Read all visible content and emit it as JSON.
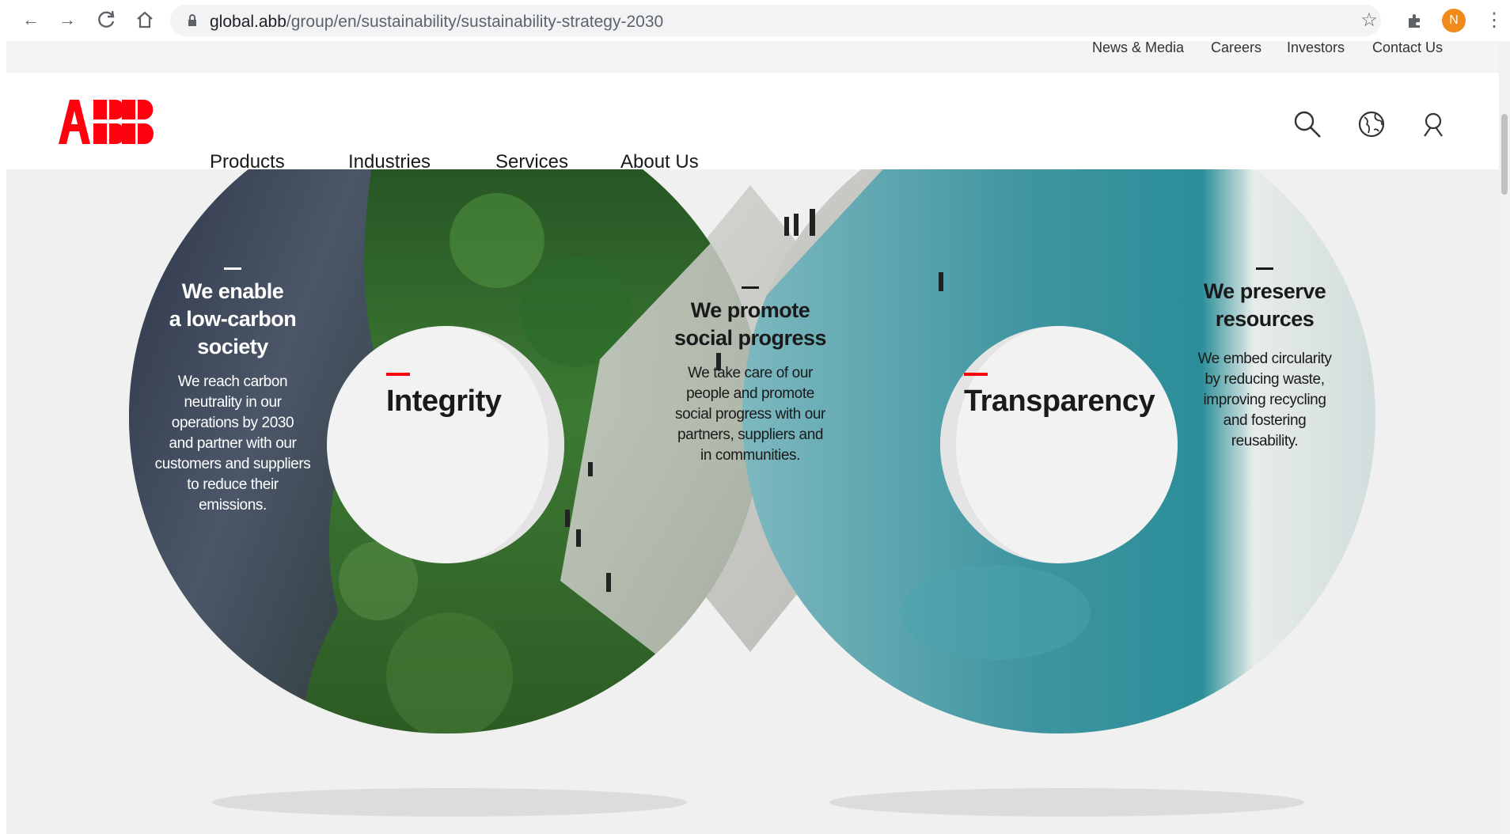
{
  "browser": {
    "url_host": "global.abb",
    "url_path": "/group/en/sustainability/sustainability-strategy-2030",
    "avatar_letter": "N"
  },
  "utility_nav": [
    "News & Media",
    "Careers",
    "Investors",
    "Contact Us"
  ],
  "main_nav": {
    "logo_text": "ABB",
    "items": [
      "Products",
      "Industries",
      "Services",
      "About Us"
    ]
  },
  "hero": {
    "left": {
      "heading_lines": [
        "We enable",
        "a low-carbon",
        "society"
      ],
      "body_lines": [
        "We reach carbon",
        "neutrality in our",
        "operations by 2030",
        "and partner with our",
        "customers and suppliers",
        "to reduce their",
        "emissions."
      ]
    },
    "integrity": "Integrity",
    "center": {
      "heading_lines": [
        "We promote",
        "social progress"
      ],
      "body_lines": [
        "We take care of our",
        "people and promote",
        "social progress with our",
        "partners, suppliers and",
        "in communities."
      ]
    },
    "transparency": "Transparency",
    "right": {
      "heading_lines": [
        "We preserve",
        "resources"
      ],
      "body_lines": [
        "We embed circularity",
        "by reducing waste,",
        "improving recycling",
        "and fostering",
        "reusability."
      ]
    }
  },
  "colors": {
    "abb_red": "#ff000f",
    "forest": "#2f5e2a",
    "sky": "#3d4a5c",
    "ocean": "#5fa9b3",
    "plaza": "#c9c9c6"
  },
  "icons": [
    "back-arrow-icon",
    "forward-arrow-icon",
    "reload-icon",
    "home-icon",
    "lock-icon",
    "star-icon",
    "extensions-icon",
    "search-icon",
    "globe-icon",
    "user-icon"
  ]
}
